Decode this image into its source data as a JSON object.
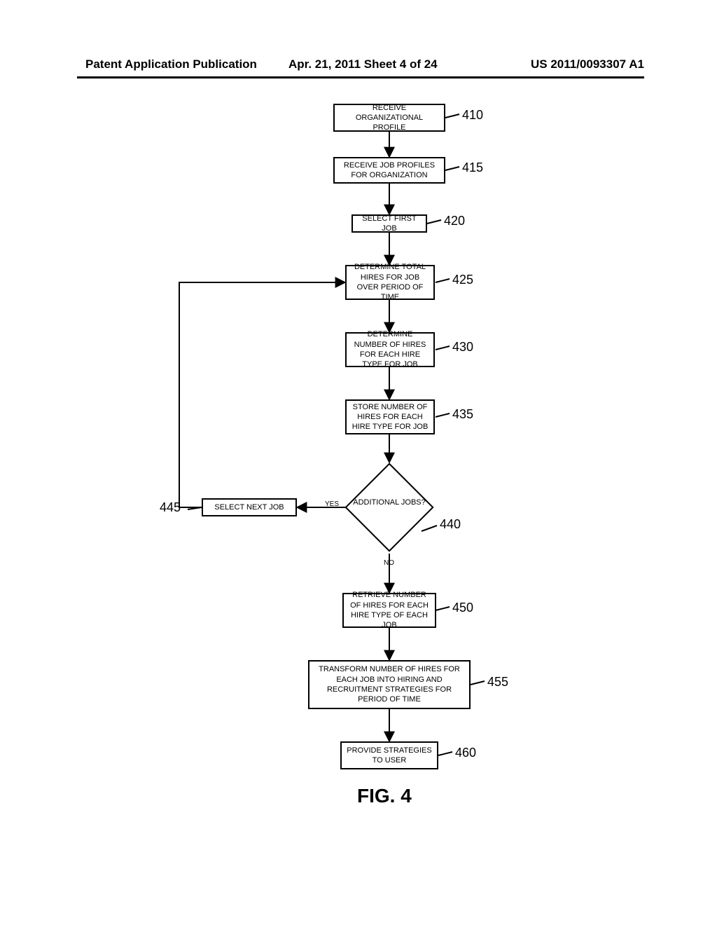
{
  "header": {
    "left": "Patent Application Publication",
    "mid": "Apr. 21, 2011  Sheet 4 of 24",
    "right": "US 2011/0093307 A1"
  },
  "boxes": {
    "b410": "RECEIVE ORGANIZATIONAL PROFILE",
    "b415": "RECEIVE JOB PROFILES FOR ORGANIZATION",
    "b420": "SELECT FIRST JOB",
    "b425": "DETERMINE TOTAL HIRES FOR JOB OVER PERIOD OF TIME",
    "b430": "DETERMINE NUMBER OF HIRES FOR EACH HIRE TYPE FOR JOB",
    "b435": "STORE NUMBER OF HIRES FOR EACH HIRE TYPE FOR JOB",
    "b445": "SELECT NEXT JOB",
    "b450": "RETRIEVE NUMBER OF HIRES FOR EACH HIRE TYPE OF EACH JOB",
    "b455": "TRANSFORM NUMBER OF HIRES FOR EACH JOB INTO HIRING AND RECRUITMENT STRATEGIES FOR PERIOD OF TIME",
    "b460": "PROVIDE STRATEGIES TO USER"
  },
  "decision": {
    "d440": "ADDITIONAL JOBS?"
  },
  "edge_labels": {
    "yes": "YES",
    "no": "NO"
  },
  "refs": {
    "r410": "410",
    "r415": "415",
    "r420": "420",
    "r425": "425",
    "r430": "430",
    "r435": "435",
    "r440": "440",
    "r445": "445",
    "r450": "450",
    "r455": "455",
    "r460": "460"
  },
  "figure_caption": "FIG. 4"
}
